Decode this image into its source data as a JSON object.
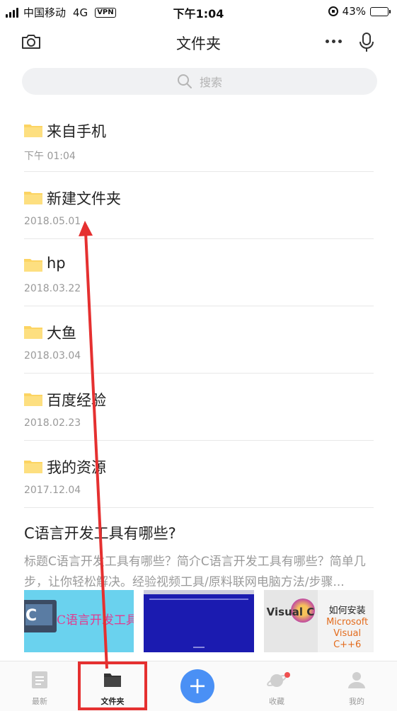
{
  "status_bar": {
    "carrier": "中国移动",
    "network": "4G",
    "vpn": "VPN",
    "time": "下午1:04",
    "battery": "43%",
    "battery_level": 0.43
  },
  "header": {
    "title": "文件夹"
  },
  "search": {
    "placeholder": "搜索"
  },
  "folders": [
    {
      "name": "来自手机",
      "date": "下午 01:04"
    },
    {
      "name": "新建文件夹",
      "date": "2018.05.01"
    },
    {
      "name": "hp",
      "date": "2018.03.22"
    },
    {
      "name": "大鱼",
      "date": "2018.03.04"
    },
    {
      "name": "百度经验",
      "date": "2018.02.23"
    },
    {
      "name": "我的资源",
      "date": "2017.12.04"
    }
  ],
  "article": {
    "title": "C语言开发工具有哪些?",
    "summary": "标题C语言开发工具有哪些？简介C语言开发工具有哪些？简单几步，让你轻松解决。经验视频工具/原料联网电脑方法/步骤...",
    "thumb1_text": "C语言开发工具有",
    "thumb1_letter": "C",
    "thumb3_brand": "Visual C",
    "thumb3_line1": "如何安装",
    "thumb3_line2": "Microsoft",
    "thumb3_line3": "Visual C++6"
  },
  "tabs": [
    {
      "label": "最新",
      "icon": "document-icon",
      "active": false
    },
    {
      "label": "文件夹",
      "icon": "folder-icon",
      "active": true
    },
    {
      "label": "+",
      "icon": "plus-icon",
      "active": false
    },
    {
      "label": "收藏",
      "icon": "planet-icon",
      "active": false
    },
    {
      "label": "我的",
      "icon": "person-icon",
      "active": false
    }
  ],
  "colors": {
    "folder": "#fcd462",
    "accent": "#4a90f5",
    "annotation": "#e53030"
  }
}
